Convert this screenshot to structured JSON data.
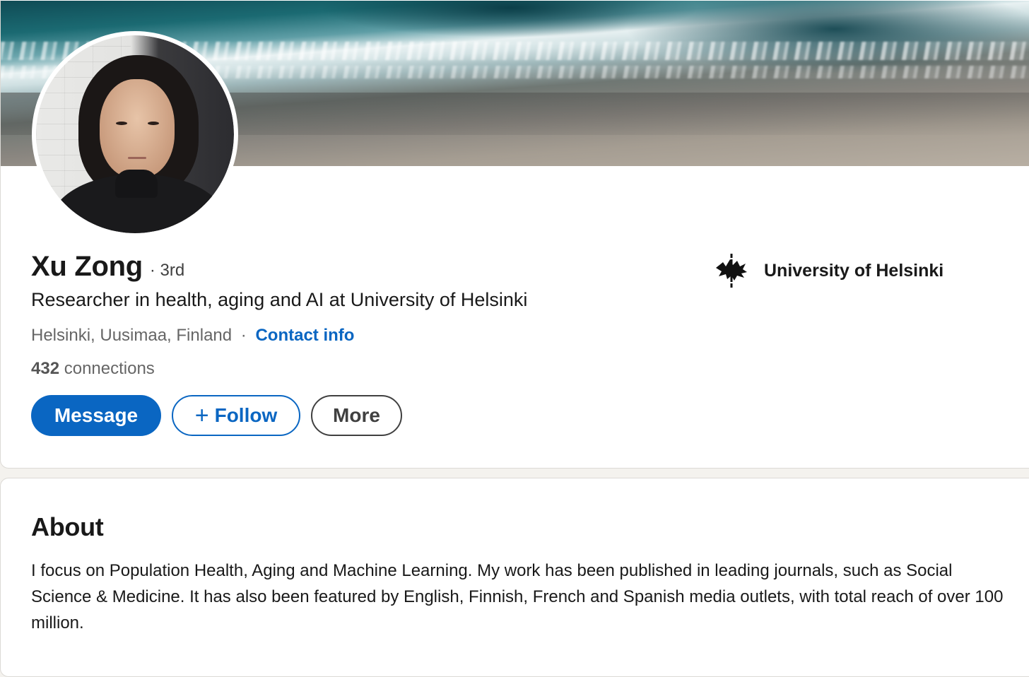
{
  "profile": {
    "name": "Xu Zong",
    "degree": "· 3rd",
    "headline": "Researcher in health, aging and AI at University of Helsinki",
    "location": "Helsinki, Uusimaa, Finland",
    "location_separator": "·",
    "contact_info_label": "Contact info",
    "connections_count": "432",
    "connections_label": "connections",
    "organization": "University of Helsinki",
    "organization_logo": "university-of-helsinki-logo",
    "banner_image": "aerial-sea-waves-beach"
  },
  "actions": {
    "message_label": "Message",
    "follow_icon": "+",
    "follow_label": "Follow",
    "more_label": "More"
  },
  "about": {
    "title": "About",
    "text": "I focus on Population Health, Aging and Machine Learning. My work has been published in leading journals, such as Social Science & Medicine. It has also been featured by English, Finnish, French and Spanish media outlets, with total reach of over 100 million."
  },
  "colors": {
    "accent": "#0a66c2",
    "text": "#191919",
    "muted": "#666666",
    "background": "#f4f2ee"
  }
}
